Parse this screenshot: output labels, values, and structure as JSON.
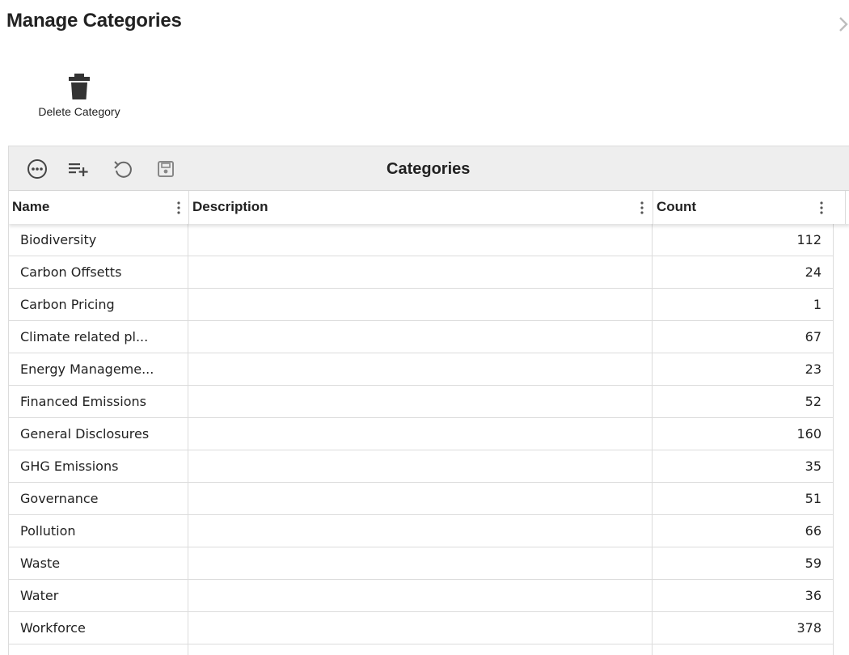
{
  "dialog": {
    "title": "Manage Categories",
    "close_icon": "chevron-right-icon"
  },
  "actions": {
    "delete_category": {
      "label": "Delete Category",
      "icon": "trash-icon"
    }
  },
  "grid": {
    "title": "Categories",
    "toolbar_icons": [
      "more-options-icon",
      "add-row-icon",
      "undo-icon",
      "save-icon"
    ],
    "columns": [
      "Name",
      "Description",
      "Count"
    ],
    "rows": [
      {
        "name": "Biodiversity",
        "description": "",
        "count": "112"
      },
      {
        "name": "Carbon Offsetts",
        "description": "",
        "count": "24"
      },
      {
        "name": "Carbon Pricing",
        "description": "",
        "count": "1"
      },
      {
        "name": "Climate related pl...",
        "description": "",
        "count": "67"
      },
      {
        "name": "Energy Manageme...",
        "description": "",
        "count": "23"
      },
      {
        "name": "Financed Emissions",
        "description": "",
        "count": "52"
      },
      {
        "name": "General Disclosures",
        "description": "",
        "count": "160"
      },
      {
        "name": "GHG Emissions",
        "description": "",
        "count": "35"
      },
      {
        "name": "Governance",
        "description": "",
        "count": "51"
      },
      {
        "name": "Pollution",
        "description": "",
        "count": "66"
      },
      {
        "name": "Waste",
        "description": "",
        "count": "59"
      },
      {
        "name": "Water",
        "description": "",
        "count": "36"
      },
      {
        "name": "Workforce",
        "description": "",
        "count": "378"
      }
    ]
  },
  "colors": {
    "toolbar_bg": "#eeeeee",
    "border": "#dcdcdc",
    "text": "#222222",
    "icon": "#444444"
  }
}
